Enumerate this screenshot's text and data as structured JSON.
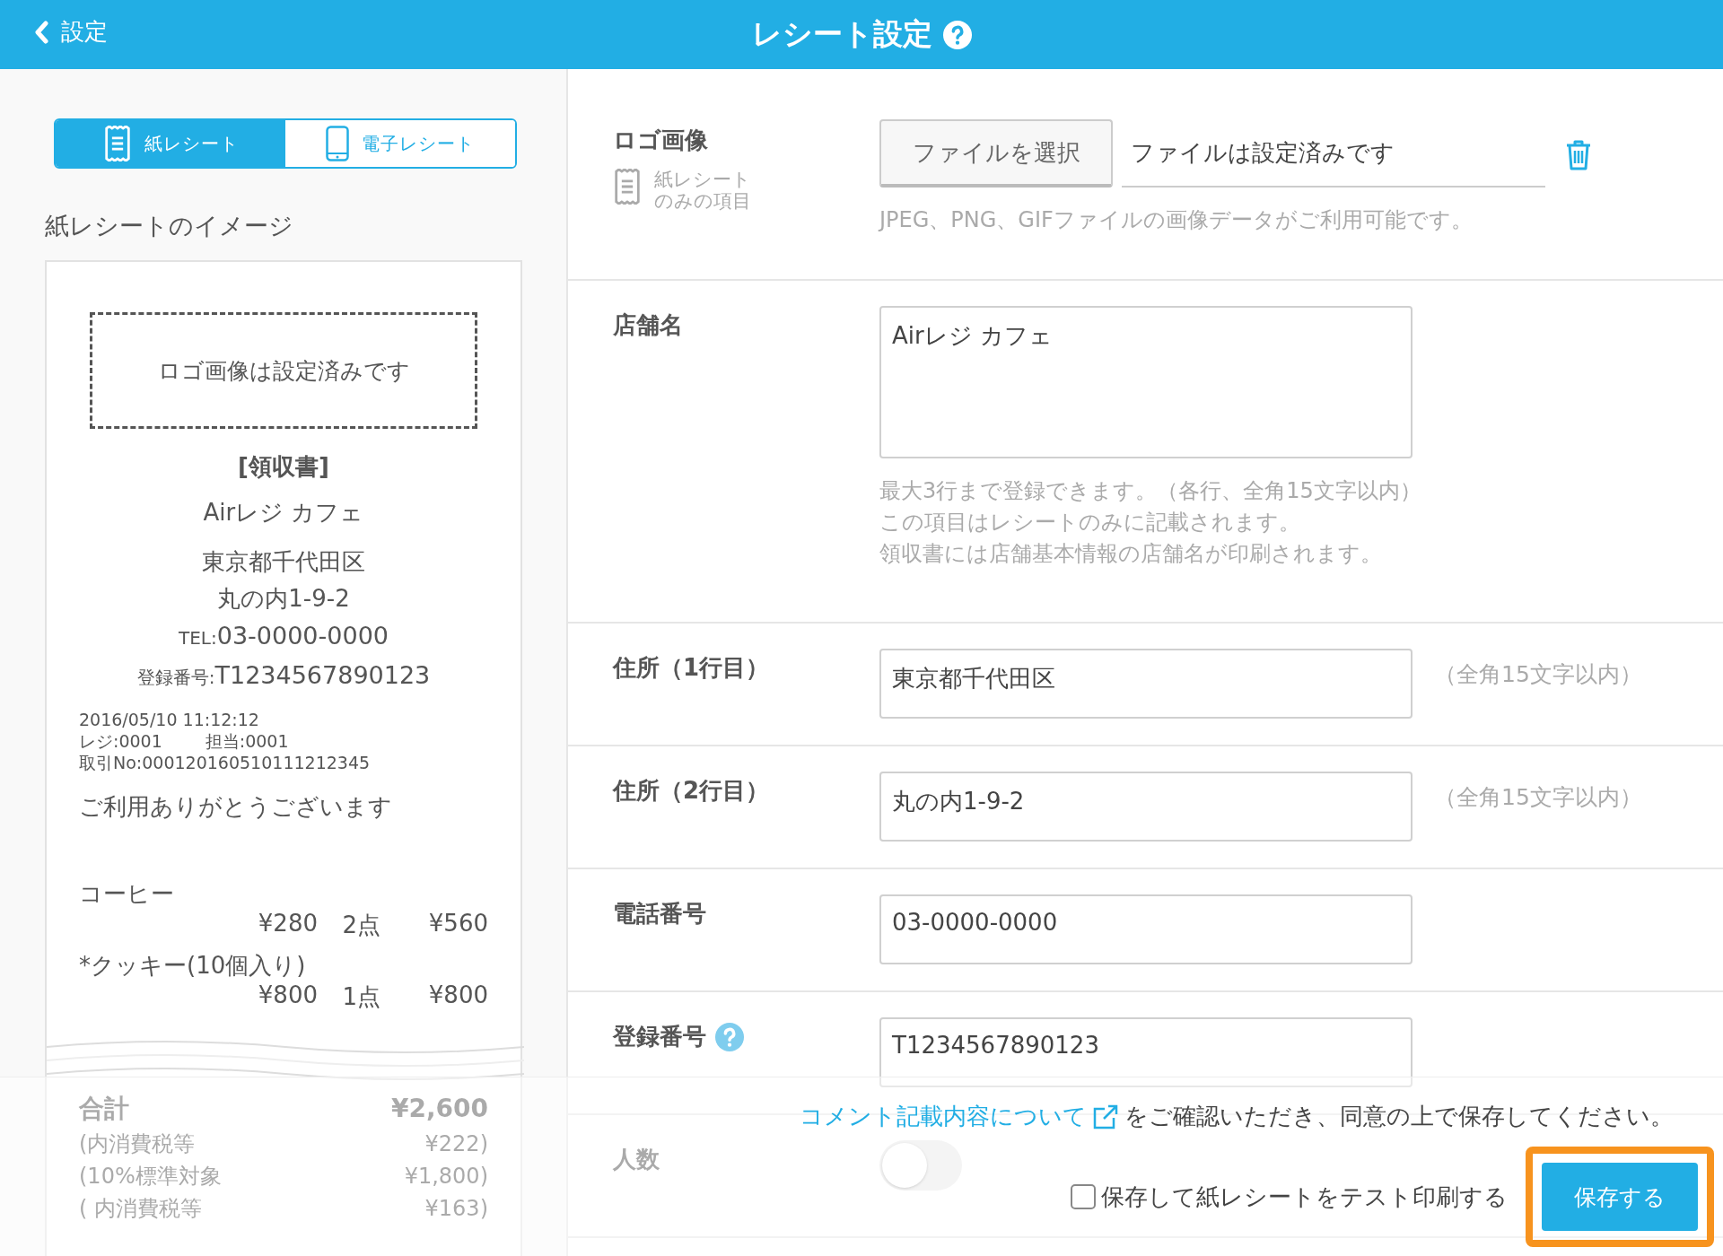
{
  "header": {
    "back_label": "設定",
    "title": "レシート設定"
  },
  "receipt_tabs": [
    {
      "label": "紙レシート",
      "kind": "paper",
      "selected": true
    },
    {
      "label": "電子レシート",
      "kind": "phone",
      "selected": false
    }
  ],
  "preview_title": "紙レシートのイメージ",
  "receipt": {
    "logo_placeholder": "ロゴ画像は設定済みです",
    "heading": "[領収書]",
    "store_name": "Airレジ カフェ",
    "address_lines": [
      "東京都千代田区",
      "丸の内1-9-2"
    ],
    "tel_label": "TEL:",
    "tel": "03-0000-0000",
    "reg_label": "登録番号:",
    "reg": "T1234567890123",
    "datetime": "2016/05/10 11:12:12",
    "register": "レジ:0001",
    "staff": "担当:0001",
    "transaction": "取引No:000120160510111212345",
    "thanks": "ご利用ありがとうございます",
    "items": [
      {
        "name": "コーヒー",
        "unit_price": "¥280",
        "qty": "2点",
        "subtotal": "¥560"
      },
      {
        "name": "*クッキー(10個入り)",
        "unit_price": "¥800",
        "qty": "1点",
        "subtotal": "¥800"
      }
    ],
    "totals": [
      {
        "label": "合計",
        "value": "¥2,600",
        "kind": "total"
      },
      {
        "label": "(内消費税等",
        "value": "¥222)",
        "kind": "sub"
      },
      {
        "label": "(10%標準対象",
        "value": "¥1,800)",
        "kind": "sub"
      },
      {
        "label": "( 内消費税等",
        "value": "¥163)",
        "kind": "sub"
      }
    ]
  },
  "form_rows": [
    {
      "kind": "file",
      "label": "ロゴ画像",
      "sub_label_lines": [
        "紙レシート",
        "のみの項目"
      ],
      "button": "ファイルを選択",
      "value": "ファイルは設定済みです",
      "notes": [
        "JPEG、PNG、GIFファイルの画像データがご利用可能です。"
      ]
    },
    {
      "kind": "textarea",
      "label": "店舗名",
      "value": "Airレジ カフェ",
      "notes": [
        "最大3行まで登録できます。（各行、全角15文字以内）",
        "この項目はレシートのみに記載されます。",
        "領収書には店舗基本情報の店舗名が印刷されます。"
      ]
    },
    {
      "kind": "text",
      "label": "住所（1行目）",
      "value": "東京都千代田区",
      "side_note": "（全角15文字以内）"
    },
    {
      "kind": "text",
      "label": "住所（2行目）",
      "value": "丸の内1-9-2",
      "side_note": "（全角15文字以内）"
    },
    {
      "kind": "text",
      "label": "電話番号",
      "value": "03-0000-0000"
    },
    {
      "kind": "text",
      "label": "登録番号",
      "value": "T1234567890123",
      "help": true
    },
    {
      "kind": "toggle",
      "label": "人数",
      "on": false
    }
  ],
  "footer": {
    "link": "コメント記載内容について",
    "notice": "をご確認いただき、同意の上で保存してください。",
    "test_print": {
      "label": "保存して紙レシートをテスト印刷する",
      "checked": false
    },
    "save_button": "保存する",
    "save_highlighted": true
  }
}
